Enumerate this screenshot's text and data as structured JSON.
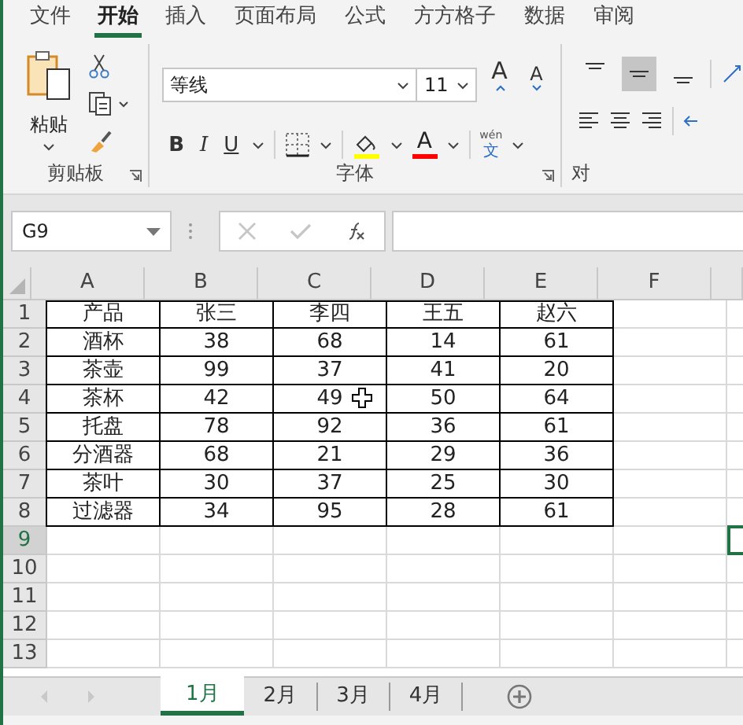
{
  "menu_tabs": [
    {
      "label": "文件",
      "selected": false
    },
    {
      "label": "开始",
      "selected": true
    },
    {
      "label": "插入",
      "selected": false
    },
    {
      "label": "页面布局",
      "selected": false
    },
    {
      "label": "公式",
      "selected": false
    },
    {
      "label": "方方格子",
      "selected": false
    },
    {
      "label": "数据",
      "selected": false
    },
    {
      "label": "审阅",
      "selected": false
    }
  ],
  "clipboard": {
    "paste_label": "粘贴",
    "group_label": "剪贴板"
  },
  "font": {
    "name": "等线",
    "size": "11",
    "grow_label": "A",
    "shrink_label": "A",
    "bold": "B",
    "italic": "I",
    "underline": "U",
    "font_color_label": "A",
    "phonetic_top": "wén",
    "phonetic_bottom": "文",
    "group_label": "字体"
  },
  "alignment": {
    "vertical_align": [
      {
        "selected": false
      },
      {
        "selected": true
      },
      {
        "selected": false
      }
    ],
    "group_label": "对"
  },
  "name_box": "G9",
  "columns": [
    "A",
    "B",
    "C",
    "D",
    "E",
    "F"
  ],
  "rows": [
    {
      "number": "1",
      "selected": false,
      "cells": [
        "产品",
        "张三",
        "李四",
        "王五",
        "赵六"
      ]
    },
    {
      "number": "2",
      "selected": false,
      "cells": [
        "酒杯",
        "38",
        "68",
        "14",
        "61"
      ]
    },
    {
      "number": "3",
      "selected": false,
      "cells": [
        "茶壶",
        "99",
        "37",
        "41",
        "20"
      ]
    },
    {
      "number": "4",
      "selected": false,
      "cells": [
        "茶杯",
        "42",
        "49",
        "50",
        "64"
      ]
    },
    {
      "number": "5",
      "selected": false,
      "cells": [
        "托盘",
        "78",
        "92",
        "36",
        "61"
      ]
    },
    {
      "number": "6",
      "selected": false,
      "cells": [
        "分酒器",
        "68",
        "21",
        "29",
        "36"
      ]
    },
    {
      "number": "7",
      "selected": false,
      "cells": [
        "茶叶",
        "30",
        "37",
        "25",
        "30"
      ]
    },
    {
      "number": "8",
      "selected": false,
      "cells": [
        "过滤器",
        "34",
        "95",
        "28",
        "61"
      ]
    },
    {
      "number": "9",
      "selected": true
    },
    {
      "number": "10",
      "selected": false
    },
    {
      "number": "11",
      "selected": false
    },
    {
      "number": "12",
      "selected": false
    },
    {
      "number": "13",
      "selected": false
    }
  ],
  "sheet_tabs": [
    {
      "label": "1月",
      "selected": true
    },
    {
      "label": "2月",
      "selected": false
    },
    {
      "label": "3月",
      "selected": false
    },
    {
      "label": "4月",
      "selected": false
    }
  ]
}
